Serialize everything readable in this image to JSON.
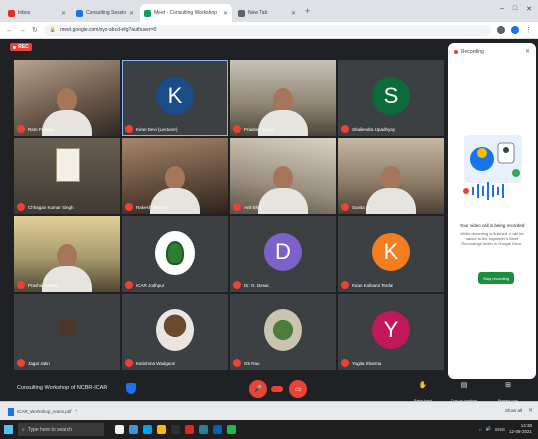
{
  "browser": {
    "tabs": [
      {
        "title": "Inbox",
        "favicon_color": "#d93025",
        "active": false
      },
      {
        "title": "Consulting Session",
        "favicon_color": "#1a73e8",
        "active": false
      },
      {
        "title": "Meet - Consulting Workshop",
        "favicon_color": "#0f9d58",
        "active": true
      },
      {
        "title": "New Tab",
        "favicon_color": "#5f6368",
        "active": false
      }
    ],
    "new_tab_label": "+",
    "url": "meet.google.com/xyz-abcd-efg?authuser=0",
    "window_controls": [
      "–",
      "□",
      "✕"
    ]
  },
  "meet": {
    "rec_label": "REC",
    "meeting_name": "Consulting Workshop of NCBR-ICAR",
    "participants": [
      {
        "name": "Ram Prasad",
        "kind": "camera",
        "style": "cam1"
      },
      {
        "name": "Kiran Devi (Lecturer)",
        "kind": "avatar",
        "letter": "K",
        "style": "k1",
        "active": true
      },
      {
        "name": "Pradeep Kumar",
        "kind": "camera",
        "style": "cam2"
      },
      {
        "name": "Shailendra Upadhyay",
        "kind": "avatar",
        "letter": "S",
        "style": "s"
      },
      {
        "name": "Chhagan Kumar Singh",
        "kind": "cert"
      },
      {
        "name": "Rakesh Sharma",
        "kind": "camera",
        "style": "cam3"
      },
      {
        "name": "Anil Bhat",
        "kind": "camera",
        "style": "cam4"
      },
      {
        "name": "Sunita B",
        "kind": "camera",
        "style": "cam5"
      },
      {
        "name": "Prashant Rathi",
        "kind": "camera",
        "style": "cam6"
      },
      {
        "name": "ICAR Jodhpur",
        "kind": "logo"
      },
      {
        "name": "Dr. G. Desai",
        "kind": "avatar",
        "letter": "D",
        "style": "d"
      },
      {
        "name": "Kiran Kulkarni Terdal",
        "kind": "avatar",
        "letter": "K",
        "style": "k2"
      },
      {
        "name": "Jagat Jatin",
        "kind": "photo",
        "style": "p4"
      },
      {
        "name": "Karishma Wadgaon",
        "kind": "photo",
        "style": "p2"
      },
      {
        "name": "G5 Rao",
        "kind": "photo",
        "style": "p3"
      },
      {
        "name": "Yogita Sharma",
        "kind": "avatar",
        "letter": "Y",
        "style": "y"
      }
    ]
  },
  "panel": {
    "title": "Recording",
    "close_icon": "close-icon",
    "heading": "Your video call is being recorded",
    "description": "While recording is finished, it will be saved to the organizer's Meet Recordings folder in Google Drive.",
    "button_label": "Stop recording"
  },
  "bottom_bar": {
    "raise_hand_label": "Raise hand",
    "captions_label": "Turn on captions",
    "present_label": "Present now"
  },
  "download": {
    "file_name": "ICAR_Workshop_notes.pdf",
    "show_all": "Show all"
  },
  "taskbar": {
    "search_placeholder": "Type here to search",
    "time": "14:38",
    "date": "12-06-2021",
    "language": "ENG",
    "icon_colors": [
      "#f0f0f0",
      "#3a96dd",
      "#00a4ef",
      "#ffb900",
      "#2f2f2f",
      "#e2241a",
      "#2d7d9a",
      "#0063b1",
      "#1db954"
    ]
  }
}
